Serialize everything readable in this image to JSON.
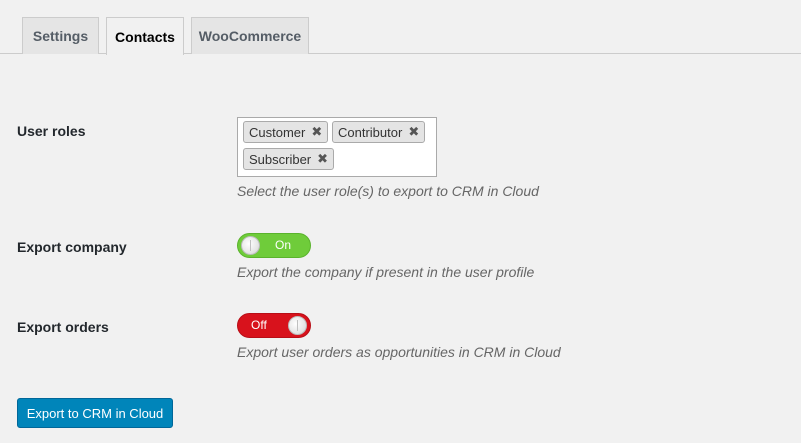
{
  "tabs": [
    {
      "label": "Settings",
      "active": false
    },
    {
      "label": "Contacts",
      "active": true
    },
    {
      "label": "WooCommerce",
      "active": false
    }
  ],
  "user_roles": {
    "label": "User roles",
    "selected": [
      "Customer",
      "Contributor",
      "Subscriber"
    ],
    "remove_glyph": "✖",
    "description": "Select the user role(s) to export to CRM in Cloud"
  },
  "export_company": {
    "label": "Export company",
    "state": "On",
    "color": "#6fcc3a",
    "description": "Export the company if present in the user profile"
  },
  "export_orders": {
    "label": "Export orders",
    "state": "Off",
    "color": "#d8121c",
    "description": "Export user orders as opportunities in CRM in Cloud"
  },
  "export_button": {
    "label": "Export to CRM in Cloud",
    "color": "#0085ba"
  }
}
